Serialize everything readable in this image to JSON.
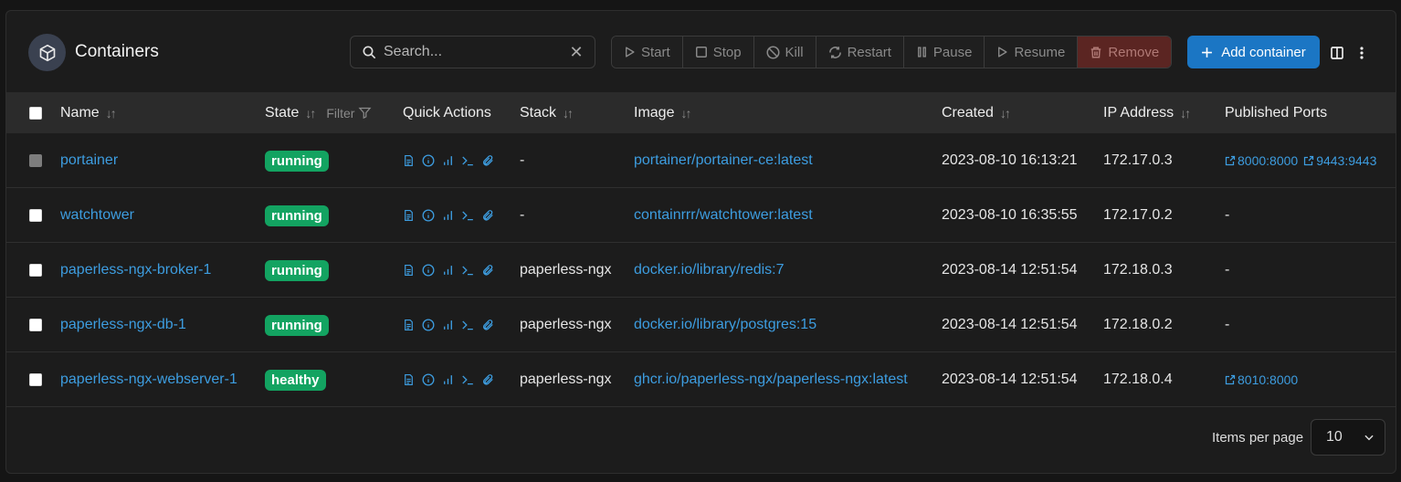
{
  "header": {
    "title": "Containers",
    "title_icon": "cube-icon"
  },
  "search": {
    "placeholder": "Search..."
  },
  "toolbar": {
    "start": "Start",
    "stop": "Stop",
    "kill": "Kill",
    "restart": "Restart",
    "pause": "Pause",
    "resume": "Resume",
    "remove": "Remove",
    "add_container": "Add container"
  },
  "table": {
    "columns": {
      "name": "Name",
      "state": "State",
      "state_filter": "Filter",
      "quick_actions": "Quick Actions",
      "stack": "Stack",
      "image": "Image",
      "created": "Created",
      "ip": "IP Address",
      "ports": "Published Ports"
    },
    "rows": [
      {
        "name": "portainer",
        "state": "running",
        "stack": "-",
        "image": "portainer/portainer-ce:latest",
        "created": "2023-08-10 16:13:21",
        "ip": "172.17.0.3",
        "ports": [
          "8000:8000",
          "9443:9443"
        ],
        "ports_text": ""
      },
      {
        "name": "watchtower",
        "state": "running",
        "stack": "-",
        "image": "containrrr/watchtower:latest",
        "created": "2023-08-10 16:35:55",
        "ip": "172.17.0.2",
        "ports": [],
        "ports_text": "-"
      },
      {
        "name": "paperless-ngx-broker-1",
        "state": "running",
        "stack": "paperless-ngx",
        "image": "docker.io/library/redis:7",
        "created": "2023-08-14 12:51:54",
        "ip": "172.18.0.3",
        "ports": [],
        "ports_text": "-"
      },
      {
        "name": "paperless-ngx-db-1",
        "state": "running",
        "stack": "paperless-ngx",
        "image": "docker.io/library/postgres:15",
        "created": "2023-08-14 12:51:54",
        "ip": "172.18.0.2",
        "ports": [],
        "ports_text": "-"
      },
      {
        "name": "paperless-ngx-webserver-1",
        "state": "healthy",
        "stack": "paperless-ngx",
        "image": "ghcr.io/paperless-ngx/paperless-ngx:latest",
        "created": "2023-08-14 12:51:54",
        "ip": "172.18.0.4",
        "ports": [
          "8010:8000"
        ],
        "ports_text": ""
      }
    ]
  },
  "footer": {
    "items_per_page_label": "Items per page",
    "items_per_page_value": "10"
  },
  "colors": {
    "accent": "#1b76c4",
    "link": "#3d9de0",
    "badge_green": "#13a361",
    "remove_bg": "#5b2522"
  }
}
